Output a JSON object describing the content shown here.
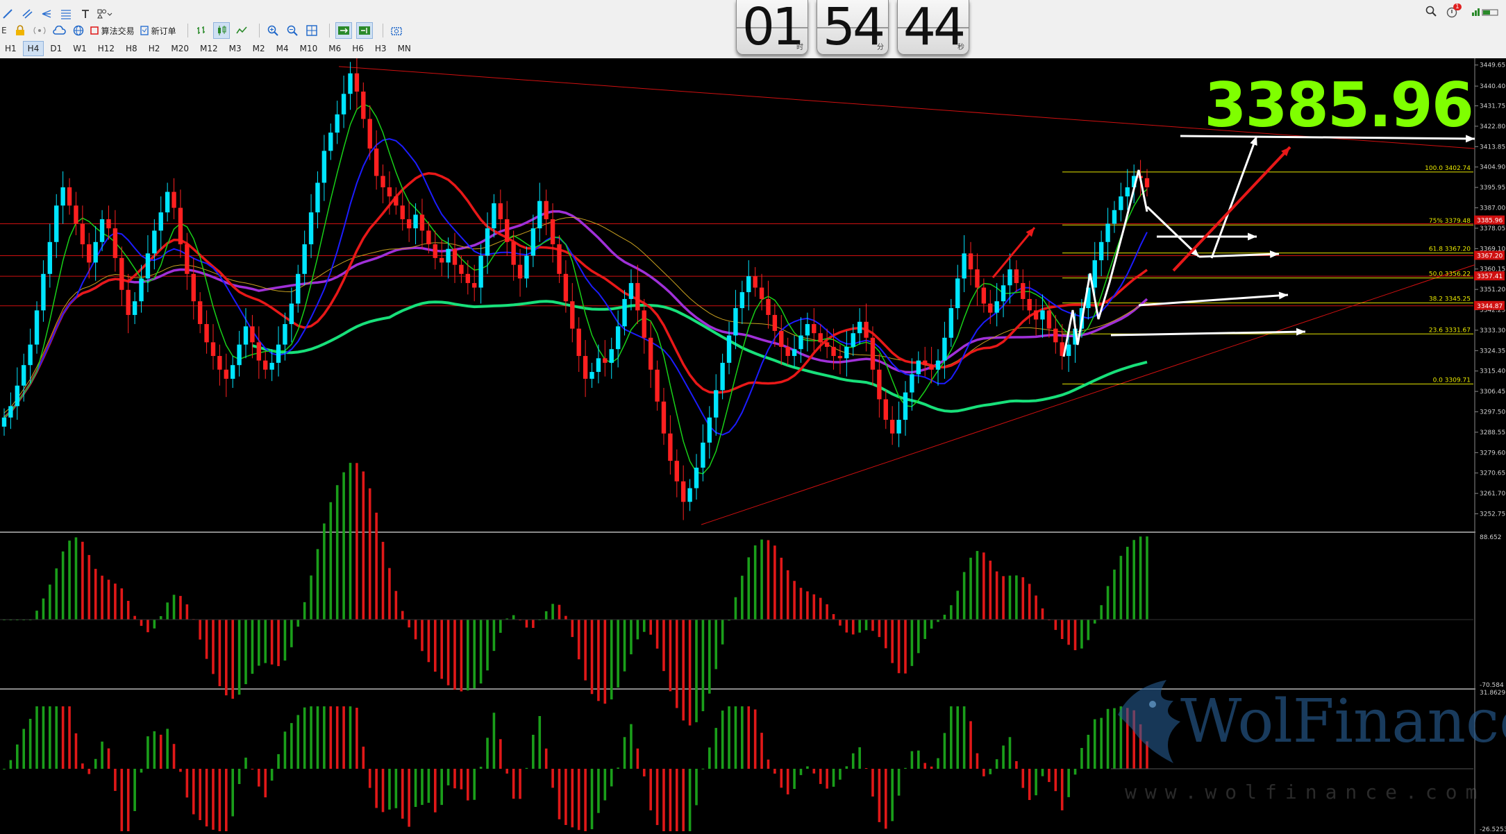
{
  "toolbar": {
    "buttons": {
      "algo_trading": "算法交易",
      "new_order": "新订单"
    },
    "timeframes": [
      "H1",
      "H4",
      "D1",
      "W1",
      "H12",
      "H8",
      "H2",
      "M20",
      "M12",
      "M3",
      "M2",
      "M4",
      "M10",
      "M6",
      "H6",
      "H3",
      "MN"
    ],
    "active_timeframe": "H4"
  },
  "clock": {
    "hours": "01",
    "minutes": "54",
    "seconds": "44",
    "unit_h": "时",
    "unit_m": "分",
    "unit_s": "秒"
  },
  "status": {
    "notifications": "1"
  },
  "price": {
    "current": "3385.96"
  },
  "axis": {
    "price_ticks": [
      "3449.65",
      "3440.40",
      "3431.75",
      "3422.80",
      "3413.85",
      "3404.90",
      "3395.95",
      "3387.00",
      "3378.05",
      "3369.10",
      "3360.15",
      "3351.20",
      "3342.25",
      "3333.30",
      "3324.35",
      "3315.40",
      "3306.45",
      "3297.50",
      "3288.55",
      "3279.60",
      "3270.65",
      "3261.70",
      "3252.75"
    ],
    "macd_top": "88.652",
    "macd_bottom": "-70.584",
    "osc_top": "31.8629",
    "osc_bottom": "-26.5253"
  },
  "price_tags": [
    "3385.96",
    "3367.20",
    "3357.41",
    "3344.87"
  ],
  "fibonacci": [
    {
      "label": "100.0  3402.74",
      "value": 3402.74
    },
    {
      "label": "75%  3379.48",
      "value": 3379.48
    },
    {
      "label": "61.8  3367.20",
      "value": 3367.2
    },
    {
      "label": "50.0  3356.22",
      "value": 3356.22
    },
    {
      "label": "38.2  3345.25",
      "value": 3345.25
    },
    {
      "label": "23.6  3331.67",
      "value": 3331.67
    },
    {
      "label": "0.0  3309.71",
      "value": 3309.71
    }
  ],
  "colors": {
    "bull": "#00e5ff",
    "bear": "#ff2020",
    "ma_fast": "#18d018",
    "ma_mid": "#1c1cff",
    "ma_slow": "#e81818",
    "ma_purple": "#a030d8",
    "ma_long": "#18e07a",
    "fib": "#e8e800",
    "price_text": "#7fff00"
  },
  "watermark": {
    "brand": "WolFinance",
    "url": "www.wolfinance.com"
  },
  "chart_data": {
    "type": "candlestick",
    "instrument_timeframe": "H4",
    "ylim": [
      3245,
      3452
    ],
    "closes": [
      3295,
      3300,
      3309,
      3318,
      3327,
      3342,
      3358,
      3372,
      3388,
      3396,
      3388,
      3380,
      3371,
      3363,
      3372,
      3382,
      3378,
      3365,
      3351,
      3340,
      3346,
      3356,
      3367,
      3377,
      3385,
      3394,
      3387,
      3371,
      3358,
      3346,
      3336,
      3328,
      3322,
      3316,
      3312,
      3318,
      3327,
      3335,
      3328,
      3320,
      3316,
      3319,
      3327,
      3336,
      3345,
      3358,
      3371,
      3385,
      3398,
      3412,
      3420,
      3428,
      3437,
      3446,
      3438,
      3426,
      3413,
      3401,
      3396,
      3392,
      3388,
      3382,
      3378,
      3384,
      3377,
      3371,
      3365,
      3363,
      3369,
      3362,
      3358,
      3354,
      3352,
      3366,
      3378,
      3389,
      3382,
      3372,
      3362,
      3356,
      3366,
      3378,
      3390,
      3382,
      3371,
      3358,
      3346,
      3334,
      3322,
      3312,
      3315,
      3321,
      3319,
      3325,
      3335,
      3347,
      3354,
      3342,
      3330,
      3316,
      3302,
      3288,
      3276,
      3267,
      3258,
      3264,
      3273,
      3284,
      3295,
      3307,
      3319,
      3331,
      3343,
      3350,
      3357,
      3352,
      3347,
      3340,
      3333,
      3326,
      3322,
      3325,
      3331,
      3336,
      3332,
      3328,
      3326,
      3322,
      3321,
      3326,
      3332,
      3337,
      3330,
      3316,
      3303,
      3294,
      3288,
      3294,
      3306,
      3314,
      3320,
      3318,
      3316,
      3320,
      3330,
      3343,
      3356,
      3367,
      3360,
      3352,
      3345,
      3341,
      3346,
      3353,
      3360,
      3354,
      3347,
      3342,
      3338,
      3342,
      3334,
      3328,
      3322,
      3327,
      3334,
      3343,
      3352,
      3364,
      3372,
      3380,
      3386,
      3392,
      3396,
      3401,
      3400,
      3396
    ],
    "series": [
      {
        "name": "MA fast",
        "color": "#18d018"
      },
      {
        "name": "MA mid",
        "color": "#1c1cff"
      },
      {
        "name": "MA slow",
        "color": "#e81818"
      },
      {
        "name": "MA purple",
        "color": "#a030d8"
      },
      {
        "name": "MA long",
        "color": "#18e07a"
      }
    ]
  }
}
